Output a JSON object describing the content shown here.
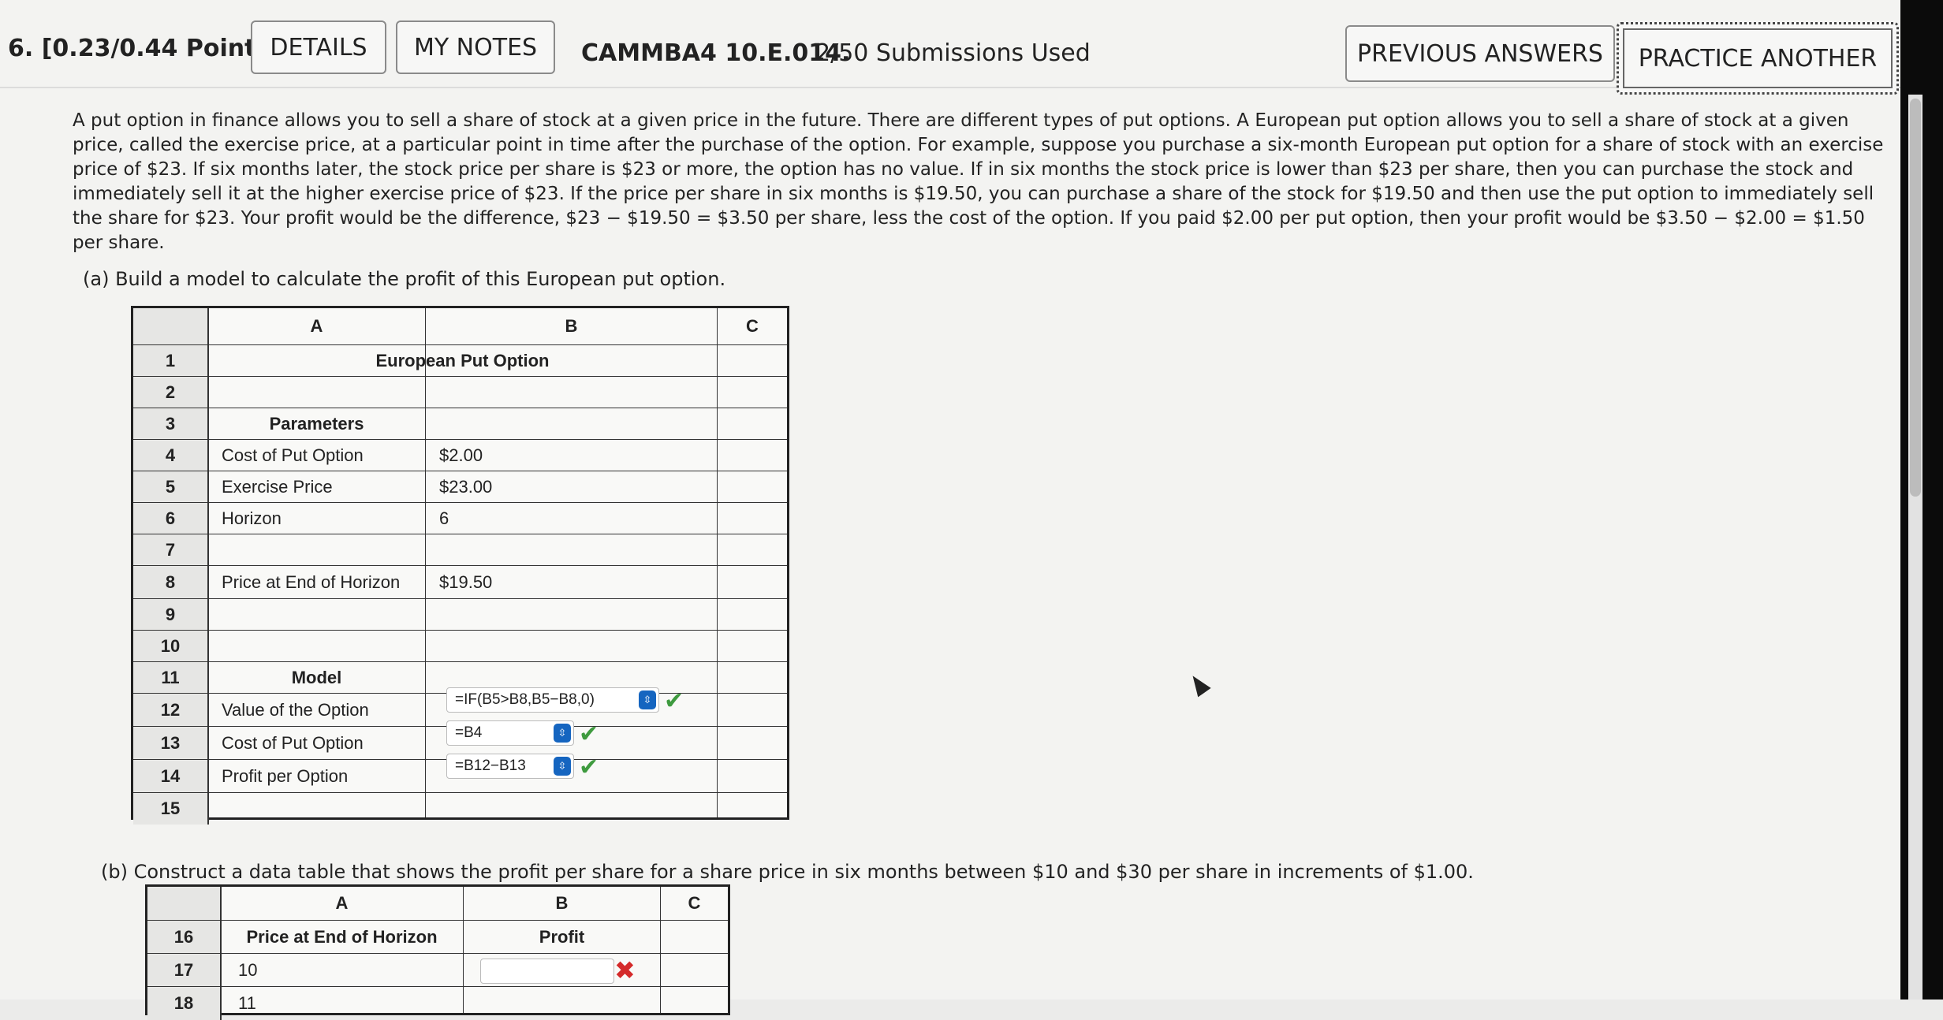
{
  "question": {
    "number_points": "6. [0.23/0.44 Points]",
    "details_label": "DETAILS",
    "notes_label": "MY NOTES",
    "code": "CAMMBA4 10.E.014.",
    "submissions": "2/50 Submissions Used",
    "previous_answers_label": "PREVIOUS ANSWERS",
    "practice_another_label": "PRACTICE ANOTHER"
  },
  "paragraph": "A put option in finance allows you to sell a share of stock at a given price in the future. There are different types of put options. A European put option allows you to sell a share of stock at a given price, called the exercise price, at a particular point in time after the purchase of the option. For example, suppose you purchase a six-month European put option for a share of stock with an exercise price of $23. If six months later, the stock price per share is $23 or more, the option has no value. If in six months the stock price is lower than $23 per share, then you can purchase the stock and immediately sell it at the higher exercise price of $23. If the price per share in six months is $19.50, you can purchase a share of the stock for $19.50 and then use the put option to immediately sell the share for $23. Your profit would be the difference, $23 − $19.50 = $3.50 per share, less the cost of the option. If you paid $2.00 per put option, then your profit would be $3.50 − $2.00 = $1.50 per share.",
  "part_a": "(a)  Build a model to calculate the profit of this European put option.",
  "part_b": "(b)  Construct a data table that shows the profit per share for a share price in six months between $10 and $30 per share in increments of $1.00.",
  "sheet1": {
    "col_a": "A",
    "col_b": "B",
    "col_c": "C",
    "rows": [
      {
        "n": "1",
        "a": "European Put Option",
        "b": ""
      },
      {
        "n": "2",
        "a": "",
        "b": ""
      },
      {
        "n": "3",
        "a": "Parameters",
        "b": ""
      },
      {
        "n": "4",
        "a": "Cost of Put Option",
        "b": "$2.00"
      },
      {
        "n": "5",
        "a": "Exercise Price",
        "b": "$23.00"
      },
      {
        "n": "6",
        "a": "Horizon",
        "b": "6"
      },
      {
        "n": "7",
        "a": "",
        "b": ""
      },
      {
        "n": "8",
        "a": "Price at End of Horizon",
        "b": "$19.50"
      },
      {
        "n": "9",
        "a": "",
        "b": ""
      },
      {
        "n": "10",
        "a": "",
        "b": ""
      },
      {
        "n": "11",
        "a": "Model",
        "b": ""
      },
      {
        "n": "12",
        "a": "Value of the Option",
        "b": "=IF(B5>B8,B5−B8,0)"
      },
      {
        "n": "13",
        "a": "Cost of Put Option",
        "b": "=B4"
      },
      {
        "n": "14",
        "a": "Profit per Option",
        "b": "=B12−B13"
      },
      {
        "n": "15",
        "a": "",
        "b": ""
      }
    ]
  },
  "sheet2": {
    "col_a": "A",
    "col_b": "B",
    "col_c": "C",
    "r16": {
      "n": "16",
      "a": "Price at End of Horizon",
      "b": "Profit"
    },
    "r17": {
      "n": "17",
      "a": "10",
      "b": ""
    },
    "r18": {
      "n": "18",
      "a": "11"
    }
  },
  "icons": {
    "check": "✔",
    "cross": "✖",
    "spinner": "⇳"
  }
}
